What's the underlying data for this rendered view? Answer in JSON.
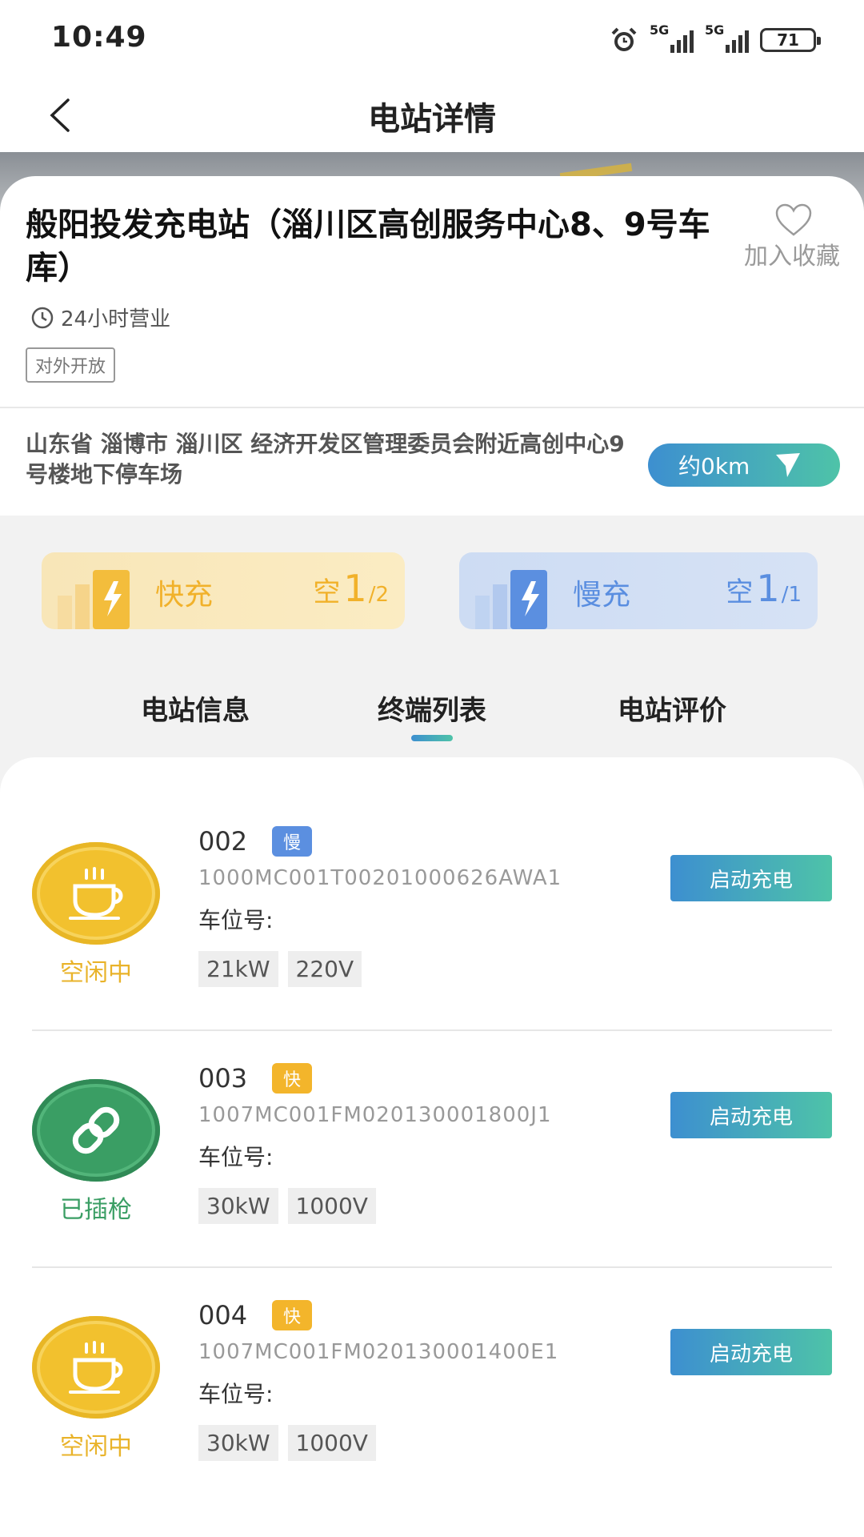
{
  "status_bar": {
    "time": "10:49",
    "sim1_label": "5G",
    "sim2_label": "5G",
    "battery": "71"
  },
  "nav": {
    "title": "电站详情"
  },
  "station": {
    "name": "般阳投发充电站（淄川区高创服务中心8、9号车库）",
    "favorite_label": "加入收藏",
    "hours": "24小时营业",
    "open_tag": "对外开放",
    "address": "山东省 淄博市 淄川区 经济开发区管理委员会附近高创中心9号楼地下停车场",
    "distance": "约0km"
  },
  "charger_types": [
    {
      "label": "快充",
      "kong": "空",
      "available": "1",
      "total": "/2",
      "color": "#f1b12a"
    },
    {
      "label": "慢充",
      "kong": "空",
      "available": "1",
      "total": "/1",
      "color": "#5a8ee0"
    }
  ],
  "tabs": [
    {
      "label": "电站信息",
      "active": false
    },
    {
      "label": "终端列表",
      "active": true
    },
    {
      "label": "电站评价",
      "active": false
    }
  ],
  "terminals": [
    {
      "number": "002",
      "speed": "慢",
      "code": "1000MC001T00201000626AWA1",
      "parking": "车位号:",
      "status": "空闲中",
      "status_icon": "coffee-cup-icon",
      "power": "21kW",
      "voltage": "220V",
      "action": "启动充电"
    },
    {
      "number": "003",
      "speed": "快",
      "code": "1007MC001FM020130001800J1",
      "parking": "车位号:",
      "status": "已插枪",
      "status_icon": "link-icon",
      "power": "30kW",
      "voltage": "1000V",
      "action": "启动充电"
    },
    {
      "number": "004",
      "speed": "快",
      "code": "1007MC001FM020130001400E1",
      "parking": "车位号:",
      "status": "空闲中",
      "status_icon": "coffee-cup-icon",
      "power": "30kW",
      "voltage": "1000V",
      "action": "启动充电"
    }
  ],
  "colors": {
    "accent_gradient_start": "#3d8fd0",
    "accent_gradient_end": "#4ec3a8",
    "idle": "#f2c12e",
    "plugged": "#3a9e64"
  }
}
